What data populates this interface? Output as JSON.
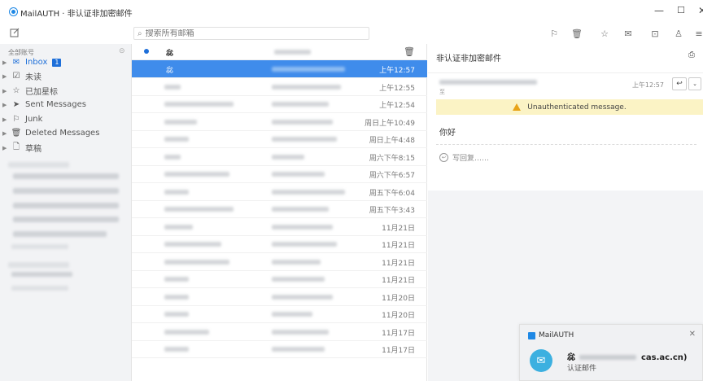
{
  "window": {
    "title": "MailAUTH · 非认证非加密邮件",
    "min_glyph": "—",
    "max_glyph": "☐",
    "close_glyph": "✕"
  },
  "toolbar": {
    "search_placeholder": "搜索所有邮箱",
    "icons": [
      "compose-icon",
      "junk-icon",
      "delete-icon",
      "star-icon",
      "mark-icon",
      "move-icon",
      "contacts-icon",
      "menu-icon"
    ]
  },
  "sidebar": {
    "header": "全部账号",
    "folders": [
      {
        "label": "Inbox",
        "icon": "✉",
        "badge": "1"
      },
      {
        "label": "未读",
        "icon": "☑"
      },
      {
        "label": "已加星标",
        "icon": "☆"
      },
      {
        "label": "Sent Messages",
        "icon": "➤"
      },
      {
        "label": "Junk",
        "icon": "⚐"
      },
      {
        "label": "Deleted Messages",
        "icon": "🗑"
      },
      {
        "label": "草稿",
        "icon": "🗋"
      }
    ]
  },
  "list": {
    "header_sender": "惢",
    "rows": [
      {
        "sender": "惢",
        "date": "上午12:57",
        "selected": true
      },
      {
        "date": "上午12:55"
      },
      {
        "date": "上午12:54"
      },
      {
        "date": "周日上午10:49"
      },
      {
        "date": "周日上午4:48"
      },
      {
        "date": "周六下午8:15"
      },
      {
        "date": "周六下午6:57"
      },
      {
        "date": "周五下午6:04"
      },
      {
        "date": "周五下午3:43"
      },
      {
        "date": "11月21日"
      },
      {
        "date": "11月21日"
      },
      {
        "date": "11月21日"
      },
      {
        "date": "11月21日"
      },
      {
        "date": "11月20日"
      },
      {
        "date": "11月20日"
      },
      {
        "date": "11月17日"
      },
      {
        "date": "11月17日"
      }
    ]
  },
  "pane": {
    "title": "非认证非加密邮件",
    "print_icon": "⎙",
    "time": "上午12:57",
    "reply_icon": "↩",
    "more_icon": "⌄",
    "to_prefix": "至",
    "warning": "Unauthenticated message.",
    "body": "你好",
    "quick_reply": "写回复……"
  },
  "notification": {
    "app": "MailAUTH",
    "from_prefix": "惢",
    "from_suffix": "cas.ac.cn)",
    "body": "认证邮件",
    "close": "✕"
  }
}
